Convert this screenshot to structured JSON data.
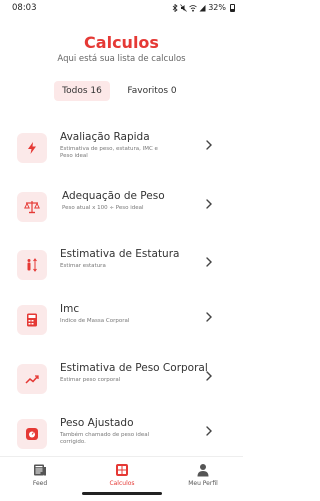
{
  "status_bar": {
    "time": "08:03",
    "battery": "32%"
  },
  "header": {
    "title": "Calculos",
    "subtitle": "Aqui está sua lista de calculos"
  },
  "tabs": [
    {
      "label": "Todos 16"
    },
    {
      "label": "Favoritos 0"
    }
  ],
  "cards": [
    {
      "title": "Avaliação Rapida",
      "description": "Estimativa de peso, estatura, IMC e Peso ideal",
      "icon": "lightning-icon"
    },
    {
      "title": "Adequação de Peso",
      "description": "Peso atual x 100 ÷ Peso ideal",
      "icon": "scale-icon"
    },
    {
      "title": "Estimativa de Estatura",
      "description": "Estimar estatura",
      "icon": "height-icon"
    },
    {
      "title": "Imc",
      "description": "Indice de Massa Corporal",
      "icon": "calculator-icon"
    },
    {
      "title": "Estimativa de Peso Corporal",
      "description": "Estimar peso corporal",
      "icon": "trend-icon"
    },
    {
      "title": "Peso Ajustado",
      "description": "Também chamado de peso ideal corrigido.",
      "icon": "weight-scale-icon"
    }
  ],
  "bottom_nav": [
    {
      "label": "Feed",
      "icon": "feed-icon"
    },
    {
      "label": "Calculos",
      "icon": "grid-icon"
    },
    {
      "label": "Meu Perfil",
      "icon": "user-icon"
    }
  ],
  "colors": {
    "accent": "#e53935",
    "icon_bg": "#fbe9e9",
    "tab_active_bg": "#fce8e8"
  }
}
